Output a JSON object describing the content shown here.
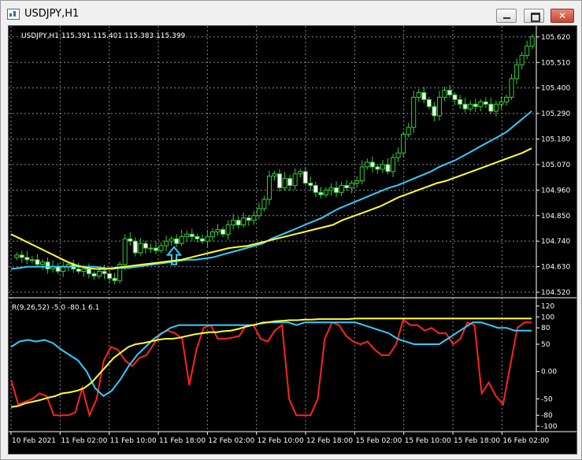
{
  "window": {
    "title": "USDJPY,H1",
    "buttons": {
      "minimize": "minimize-icon",
      "maximize": "maximize-icon",
      "close": "close-icon"
    }
  },
  "chart_data": [
    {
      "type": "candlestick",
      "header": "USDJPY,H1  115.391 115.401 115.383 115.399",
      "ylim": [
        104.52,
        105.65
      ],
      "y_ticks": [
        "105.620",
        "105.510",
        "105.400",
        "105.290",
        "105.180",
        "105.070",
        "104.960",
        "104.850",
        "104.740",
        "104.630",
        "104.520"
      ],
      "y_tick_values": [
        105.62,
        105.51,
        105.4,
        105.29,
        105.18,
        105.07,
        104.96,
        104.85,
        104.74,
        104.63,
        104.52
      ],
      "grid": true,
      "candle_colors": {
        "up": "#000000",
        "down": "#ffffff",
        "outline": "#33cc33"
      },
      "closes": [
        104.68,
        104.67,
        104.66,
        104.66,
        104.64,
        104.65,
        104.62,
        104.63,
        104.61,
        104.63,
        104.64,
        104.62,
        104.61,
        104.62,
        104.6,
        104.59,
        104.61,
        104.6,
        104.58,
        104.57,
        104.64,
        104.75,
        104.74,
        104.69,
        104.73,
        104.71,
        104.71,
        104.7,
        104.72,
        104.74,
        104.75,
        104.73,
        104.76,
        104.77,
        104.76,
        104.75,
        104.74,
        104.76,
        104.78,
        104.79,
        104.77,
        104.81,
        104.83,
        104.81,
        104.84,
        104.83,
        104.85,
        104.88,
        104.92,
        105.02,
        105.03,
        104.97,
        105.01,
        104.98,
        105.03,
        105.04,
        104.99,
        104.98,
        104.95,
        104.94,
        104.96,
        104.97,
        104.95,
        104.98,
        104.97,
        104.99,
        105.0,
        105.06,
        105.08,
        105.06,
        105.05,
        105.07,
        105.04,
        105.1,
        105.12,
        105.2,
        105.23,
        105.36,
        105.38,
        105.35,
        105.32,
        105.28,
        105.36,
        105.39,
        105.37,
        105.35,
        105.33,
        105.31,
        105.33,
        105.32,
        105.34,
        105.33,
        105.3,
        105.33,
        105.34,
        105.36,
        105.44,
        105.5,
        105.54,
        105.58,
        105.62
      ],
      "series": [
        {
          "name": "fast-ma",
          "color": "#33ccff",
          "values": [
            104.62,
            104.625,
            104.63,
            104.63,
            104.63,
            104.63,
            104.63,
            104.63,
            104.63,
            104.63,
            104.63,
            104.625,
            104.62,
            104.625,
            104.625,
            104.63,
            104.635,
            104.64,
            104.645,
            104.65,
            104.655,
            104.66,
            104.66,
            104.665,
            104.67,
            104.68,
            104.69,
            104.7,
            104.71,
            104.72,
            104.73,
            104.75,
            104.765,
            104.78,
            104.795,
            104.81,
            104.825,
            104.84,
            104.86,
            104.88,
            104.895,
            104.91,
            104.925,
            104.94,
            104.955,
            104.97,
            104.98,
            104.995,
            105.01,
            105.025,
            105.04,
            105.06,
            105.075,
            105.09,
            105.11,
            105.13,
            105.15,
            105.17,
            105.19,
            105.21,
            105.24,
            105.27,
            105.3
          ]
        },
        {
          "name": "slow-ma",
          "color": "#ffff33",
          "values": [
            104.77,
            104.75,
            104.73,
            104.71,
            104.69,
            104.67,
            104.65,
            104.635,
            104.625,
            104.62,
            104.62,
            104.625,
            104.63,
            104.635,
            104.64,
            104.645,
            104.65,
            104.655,
            104.66,
            104.67,
            104.68,
            104.69,
            104.7,
            104.71,
            104.715,
            104.72,
            104.73,
            104.74,
            104.75,
            104.76,
            104.77,
            104.78,
            104.79,
            104.8,
            104.81,
            104.83,
            104.845,
            104.86,
            104.875,
            104.89,
            104.91,
            104.93,
            104.945,
            104.96,
            104.975,
            104.99,
            105.0,
            105.015,
            105.03,
            105.045,
            105.06,
            105.075,
            105.09,
            105.105,
            105.12,
            105.14
          ]
        }
      ],
      "signal_arrow": "up-arrow-icon"
    },
    {
      "type": "line",
      "header": "R(9,26,52) -5.0 -80.1 6.1",
      "ylim": [
        -110,
        125
      ],
      "y_ticks": [
        "120",
        "100",
        "80",
        "50",
        "0.00",
        "-50",
        "-80",
        "-100"
      ],
      "y_tick_values": [
        120,
        100,
        80,
        50,
        0,
        -50,
        -80,
        -100
      ],
      "series": [
        {
          "name": "fast",
          "color": "#ff2222",
          "values": [
            -15,
            -60,
            -55,
            -50,
            -40,
            -45,
            -80,
            -80,
            -80,
            -75,
            -30,
            -80,
            -50,
            20,
            45,
            40,
            20,
            10,
            25,
            30,
            50,
            70,
            75,
            70,
            60,
            -25,
            40,
            80,
            85,
            60,
            60,
            62,
            65,
            85,
            85,
            60,
            55,
            75,
            85,
            -50,
            -80,
            -80,
            -80,
            -50,
            60,
            90,
            85,
            65,
            55,
            50,
            55,
            40,
            30,
            30,
            50,
            95,
            85,
            85,
            75,
            80,
            70,
            70,
            50,
            60,
            90,
            85,
            -40,
            -20,
            -45,
            -60,
            10,
            80,
            90,
            90
          ]
        },
        {
          "name": "mid",
          "color": "#33ccff",
          "values": [
            45,
            55,
            58,
            55,
            58,
            52,
            40,
            30,
            20,
            0,
            -30,
            -45,
            -35,
            -15,
            10,
            30,
            45,
            60,
            70,
            80,
            85,
            85,
            85,
            85,
            85,
            85,
            85,
            85,
            85,
            85,
            90,
            90,
            90,
            90,
            85,
            90,
            90,
            90,
            90,
            90,
            90,
            90,
            85,
            80,
            75,
            70,
            60,
            55,
            50,
            50,
            50,
            50,
            60,
            70,
            80,
            90,
            90,
            85,
            80,
            80,
            75,
            75,
            75
          ]
        },
        {
          "name": "slow",
          "color": "#ffff33",
          "values": [
            -65,
            -63,
            -58,
            -55,
            -52,
            -48,
            -45,
            -40,
            -38,
            -35,
            -30,
            -20,
            -5,
            10,
            25,
            35,
            45,
            50,
            52,
            55,
            58,
            60,
            60,
            62,
            65,
            68,
            70,
            72,
            72,
            74,
            75,
            78,
            82,
            85,
            88,
            90,
            92,
            93,
            94,
            94,
            95,
            95,
            96,
            96,
            96,
            96,
            96,
            97,
            97,
            97,
            97,
            97,
            97,
            97,
            97,
            97,
            97,
            97,
            97,
            97,
            97,
            97,
            97,
            97,
            97,
            97,
            97,
            97,
            97,
            97,
            97,
            97
          ]
        }
      ]
    }
  ],
  "x_axis": {
    "labels": [
      "10 Feb 2021",
      "11 Feb 02:00",
      "11 Feb 10:00",
      "11 Feb 18:00",
      "12 Feb 02:00",
      "12 Feb 10:00",
      "12 Feb 18:00",
      "15 Feb 02:00",
      "15 Feb 10:00",
      "15 Feb 18:00",
      "16 Feb 02:00"
    ]
  }
}
